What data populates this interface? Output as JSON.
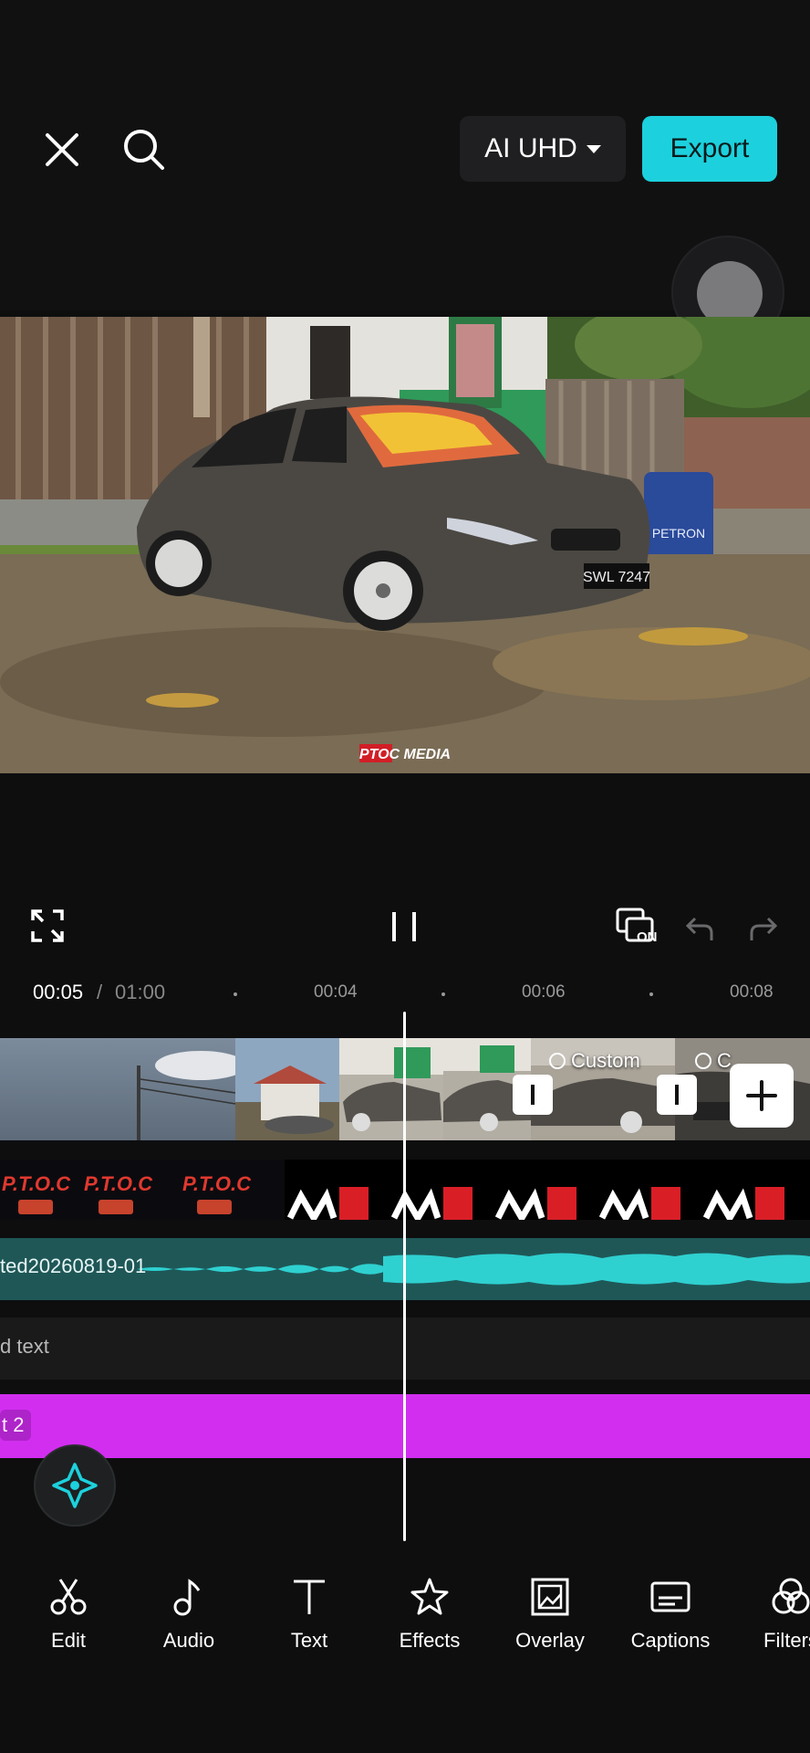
{
  "header": {
    "quality_label": "AI UHD",
    "export_label": "Export"
  },
  "preview": {
    "watermark": "PTOC MEDIA",
    "sign_text": "PETRON",
    "plate_text": "SWL 7247"
  },
  "playback": {
    "current_time": "00:05",
    "separator": "/",
    "total_time": "01:00",
    "ticks": [
      "00:04",
      "00:06",
      "00:08"
    ],
    "keyframe_badge": "ON"
  },
  "tracks": {
    "video": {
      "transition_labels": [
        "Custom",
        "C"
      ]
    },
    "audio": {
      "clip_name": "ted20260819-01"
    },
    "text": {
      "clip_name": "d text"
    },
    "effect": {
      "clip_name": "t 2"
    }
  },
  "toolbar": {
    "items": [
      {
        "label": "Edit",
        "icon": "scissors-icon"
      },
      {
        "label": "Audio",
        "icon": "music-note-icon"
      },
      {
        "label": "Text",
        "icon": "text-icon"
      },
      {
        "label": "Effects",
        "icon": "star-effects-icon"
      },
      {
        "label": "Overlay",
        "icon": "overlay-icon"
      },
      {
        "label": "Captions",
        "icon": "captions-icon"
      },
      {
        "label": "Filters",
        "icon": "filters-icon"
      }
    ]
  },
  "colors": {
    "accent": "#1cd1dd",
    "audio_track": "#1f5757",
    "waveform": "#2fd0d0",
    "effect_track": "#d22ef0"
  }
}
